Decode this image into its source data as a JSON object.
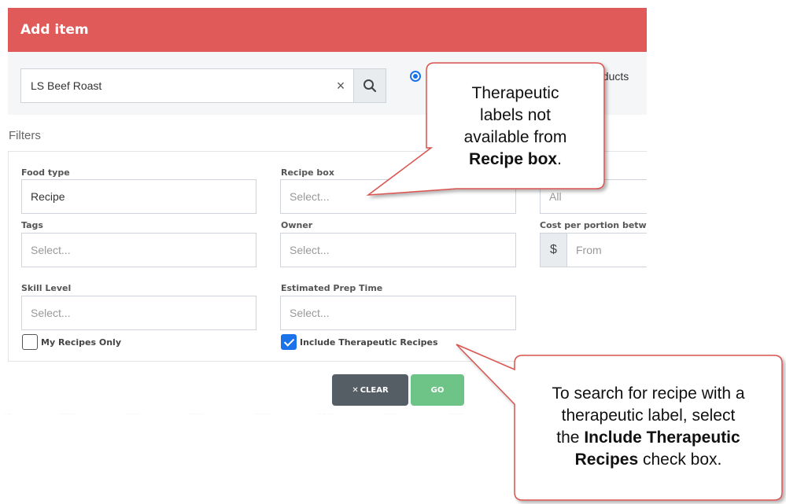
{
  "dialog": {
    "title": "Add item"
  },
  "search": {
    "value": "LS Beef Roast",
    "clear_glyph": "×"
  },
  "radio": {
    "partial_label": "oducts"
  },
  "filters": {
    "title": "Filters",
    "food_type": {
      "label": "Food type",
      "value": "Recipe"
    },
    "recipe_box": {
      "label": "Recipe box",
      "placeholder": "Select..."
    },
    "third_col_select": {
      "value": "All"
    },
    "tags": {
      "label": "Tags",
      "placeholder": "Select..."
    },
    "owner": {
      "label": "Owner",
      "placeholder": "Select..."
    },
    "cost": {
      "label": "Cost per portion betw",
      "prefix": "$",
      "from_placeholder": "From"
    },
    "skill_level": {
      "label": "Skill Level",
      "placeholder": "Select..."
    },
    "prep_time": {
      "label": "Estimated Prep Time",
      "placeholder": "Select..."
    },
    "my_recipes_only": {
      "label": "My Recipes Only",
      "checked": false
    },
    "include_therapeutic": {
      "label": "Include Therapeutic Recipes",
      "checked": true
    }
  },
  "buttons": {
    "clear_label": "CLEAR",
    "clear_glyph": "✕",
    "go_label": "GO"
  },
  "callout_top": {
    "line1": "Therapeutic",
    "line2": "labels not",
    "line3": "available from",
    "bold": "Recipe box",
    "tail": "."
  },
  "callout_bottom": {
    "line1": "To search for recipe with a",
    "line2": "therapeutic label, select",
    "line3_pre": "the ",
    "line3_bold": "Include Therapeutic",
    "line4_bold": "Recipes",
    "line4_post": " check box."
  },
  "colors": {
    "header": "#e05a5a",
    "callout_border": "#d9534f",
    "checkbox_checked": "#1a73e8",
    "clear_button": "#555d65",
    "go_button": "#6ec487"
  }
}
